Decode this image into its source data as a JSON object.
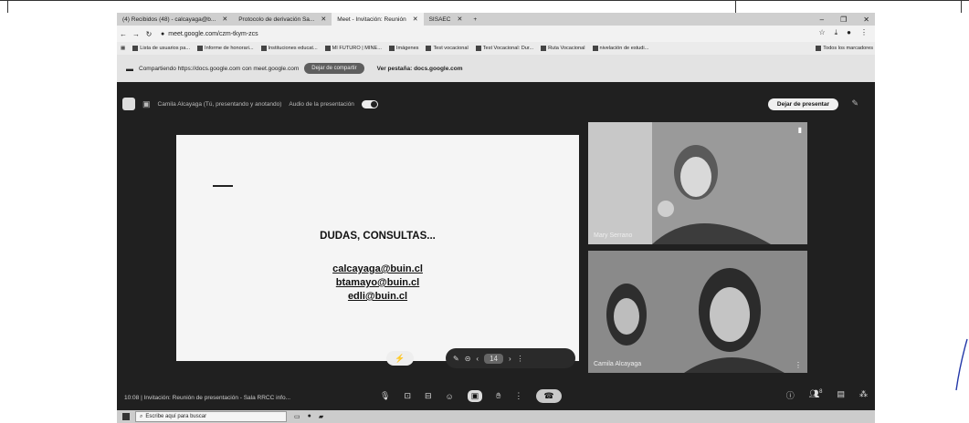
{
  "tabs": [
    {
      "label": "(4) Recibidos (48) - calcayaga@b...",
      "active": false
    },
    {
      "label": "Protocolo de derivación Sa...",
      "active": false
    },
    {
      "label": "Meet - Invitación: Reunión",
      "active": true
    },
    {
      "label": "SISAEC",
      "active": false
    }
  ],
  "address": {
    "url": "meet.google.com/czm-tkym-zcs"
  },
  "bookmarks": [
    "Lista de usuarios pa...",
    "Informe de honorari...",
    "Instituciones educat...",
    "MI FUTURO | MINE...",
    "Imágenes",
    "Test vocacional",
    "Test Vocacional: Dur...",
    "Ruta Vocacional",
    "nivelación de estudi...",
    "Todos los marcadores"
  ],
  "share_bar": {
    "text": "Compartiendo https://docs.google.com con meet.google.com",
    "stop_label": "Dejar de compartir",
    "switch_label": "Ver pestaña: docs.google.com"
  },
  "meet": {
    "presenter_text": "Camila Alcayaga (Tú, presentando y anotando)",
    "audio_label": "Audio de la presentación",
    "stop_present_label": "Dejar de presentar",
    "slide": {
      "title": "DUDAS, CONSULTAS...",
      "emails": [
        "calcayaga@buin.cl",
        "btamayo@buin.cl",
        "edli@buin.cl"
      ]
    },
    "page_number": "14",
    "participants": [
      {
        "name": "Mary Serrano"
      },
      {
        "name": "Camila Alcayaga"
      }
    ],
    "time": "10:08",
    "meeting_title": "Invitación: Reunión de presentación - Sala RRCC info...",
    "participant_count": "8"
  },
  "taskbar": {
    "search_placeholder": "Escribe aquí para buscar"
  }
}
